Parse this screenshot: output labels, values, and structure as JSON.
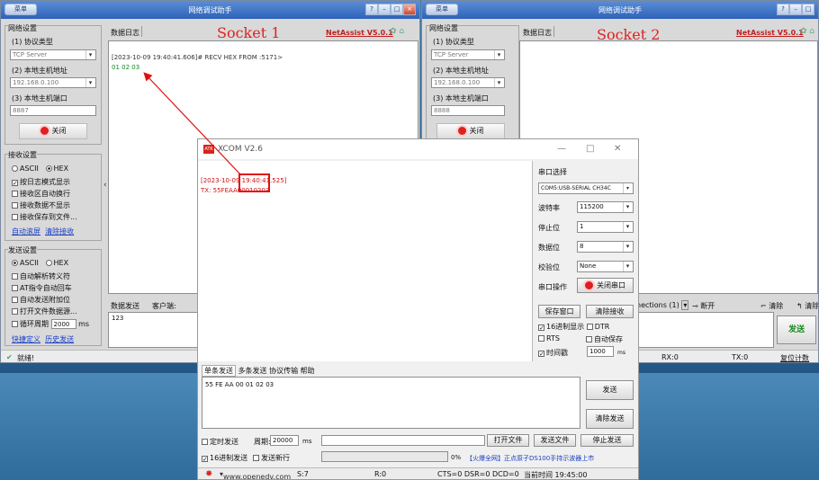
{
  "left_win": {
    "title": "网络调试助手",
    "menu_btn": "菜单",
    "net_settings": "网络设置",
    "protocol_label": "(1) 协议类型",
    "protocol": "TCP Server",
    "host_label": "(2) 本地主机地址",
    "host": "192.168.0.100",
    "port_label": "(3) 本地主机端口",
    "port": "8887",
    "close_btn": "关闭",
    "log_label": "数据日志",
    "socket_title": "Socket 1",
    "brand": "NetAssist V5.0.1",
    "log_line1": "[2023-10-09 19:40:41.606]# RECV HEX FROM :5171>",
    "log_line2": "01 02 03",
    "recv_settings": "接收设置",
    "recv_ascii": "ASCII",
    "recv_hex": "HEX",
    "recv_opt1": "按日志模式显示",
    "recv_opt2": "接收区自动换行",
    "recv_opt3": "接收数据不显示",
    "recv_opt4": "接收保存到文件...",
    "link_autoscroll": "自动滚屏",
    "link_clear": "清除接收",
    "send_settings": "发送设置",
    "send_ascii": "ASCII",
    "send_hex": "HEX",
    "send_opt1": "自动解析转义符",
    "send_opt2": "AT指令自动回车",
    "send_opt3": "自动发送附加位",
    "send_opt4": "打开文件数据源...",
    "send_opt5": "循环周期",
    "cycle_value": "2000",
    "cycle_unit": "ms",
    "link_shortcut": "快捷定义",
    "link_history": "历史发送",
    "send_tab": "数据发送",
    "client_label": "客户端:",
    "send_text": "123",
    "status": "就绪!"
  },
  "right_win": {
    "title": "网络调试助手",
    "menu_btn": "菜单",
    "net_settings": "网络设置",
    "protocol_label": "(1) 协议类型",
    "protocol": "TCP Server",
    "host_label": "(2) 本地主机地址",
    "host": "192.168.0.100",
    "port_label": "(3) 本地主机端口",
    "port": "8888",
    "close_btn": "关闭",
    "log_label": "数据日志",
    "socket_title": "Socket 2",
    "brand": "NetAssist V5.0.1",
    "connections": "nections (1)",
    "disconnect": "断开",
    "clear_label": "清除",
    "clear_label2": "清除",
    "send_btn": "发送",
    "rx": "RX:0",
    "tx": "TX:0",
    "reset_count": "复位计数"
  },
  "xcom": {
    "title": "XCOM V2.6",
    "log_line1": "[2023-10-09 19:40:41.525]",
    "log_line2": "TX: 55FEAA00010203",
    "port_select_label": "串口选择",
    "port_select": "COM5:USB-SERIAL CH34C",
    "baud_label": "波特率",
    "baud": "115200",
    "stop_label": "停止位",
    "stop": "1",
    "data_label": "数据位",
    "data": "8",
    "parity_label": "校验位",
    "parity": "None",
    "op_label": "串口操作",
    "close_port": "关闭串口",
    "save_window": "保存窗口",
    "clear_recv": "清除接收",
    "hex_display": "16进制显示",
    "dtr": "DTR",
    "rts": "RTS",
    "auto_save": "自动保存",
    "timestamp": "时间戳",
    "ts_value": "1000",
    "ts_unit": "ms",
    "tabs": [
      "单条发送",
      "多条发送",
      "协议传输",
      "帮助"
    ],
    "send_text": "55 FE AA 00 01 02 03",
    "send_btn": "发送",
    "clear_send": "清除发送",
    "timed_send": "定时发送",
    "period_label": "周期:",
    "period": "20000",
    "period_unit": "ms",
    "open_file": "打开文件",
    "send_file": "发送文件",
    "stop_send": "停止发送",
    "hex_send": "16进制发送",
    "newline": "发送新行",
    "progress": "0%",
    "promo": "【火爆全网】正点原子DS100手持示波器上市",
    "url": "www.openedv.com",
    "s": "S:7",
    "r": "R:0",
    "signals": "CTS=0 DSR=0 DCD=0",
    "time": "当前时间 19:45:00"
  },
  "annotation_color": "#e01010"
}
